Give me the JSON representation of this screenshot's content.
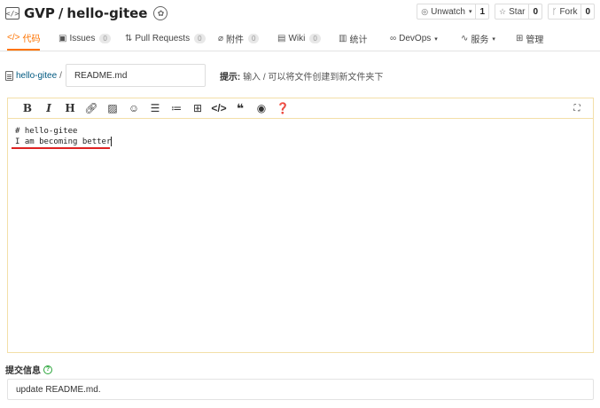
{
  "repo": {
    "owner": "GVP",
    "separator": "/",
    "name": "hello-gitee",
    "icon": "repo-icon",
    "badge_icon": "gvp-badge-icon"
  },
  "actions": {
    "watch_label": "Unwatch",
    "watch_count": "1",
    "star_label": "Star",
    "star_count": "0",
    "fork_label": "Fork",
    "fork_count": "0"
  },
  "tabs": [
    {
      "label": "代码",
      "icon": "code-icon",
      "active": true
    },
    {
      "label": "Issues",
      "icon": "issues-icon",
      "badge": "0"
    },
    {
      "label": "Pull Requests",
      "icon": "pull-request-icon",
      "badge": "0"
    },
    {
      "label": "附件",
      "icon": "attachment-icon",
      "badge": "0"
    },
    {
      "label": "Wiki",
      "icon": "wiki-icon",
      "badge": "0"
    },
    {
      "label": "统计",
      "icon": "stats-icon"
    },
    {
      "label": "DevOps",
      "icon": "devops-icon",
      "dropdown": true
    },
    {
      "label": "服务",
      "icon": "service-icon",
      "dropdown": true
    },
    {
      "label": "管理",
      "icon": "manage-icon"
    }
  ],
  "path": {
    "repo_link": "hello-gitee",
    "separator": "/",
    "file_name": "README.md",
    "hint_label": "提示:",
    "hint_text": "输入 / 可以将文件创建到新文件夹下"
  },
  "editor": {
    "toolbar": [
      "bold",
      "italic",
      "heading",
      "link",
      "image",
      "emoji",
      "unordered-list",
      "ordered-list",
      "table",
      "code",
      "quote",
      "preview",
      "help"
    ],
    "lines": [
      "# hello-gitee",
      "I am becoming better"
    ]
  },
  "commit": {
    "label": "提交信息",
    "value": "update README.md."
  },
  "colors": {
    "accent": "#fe7300",
    "link": "#005980",
    "editor_border": "#f3dfa8",
    "annotation": "#dd2222",
    "help": "#2aa53a"
  }
}
